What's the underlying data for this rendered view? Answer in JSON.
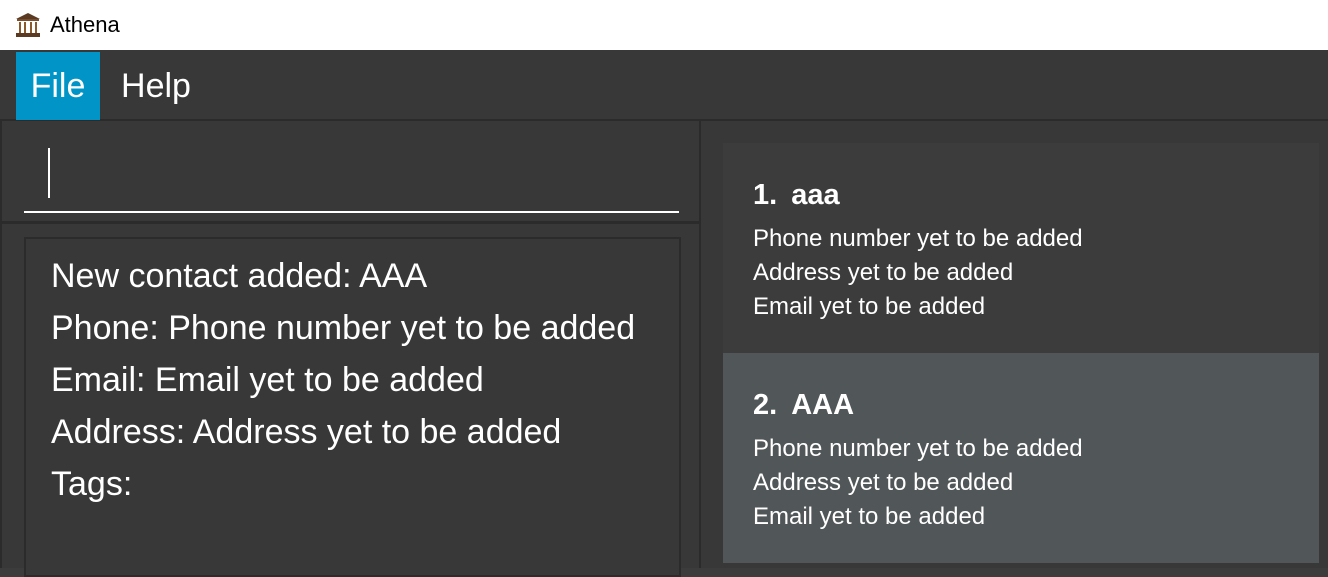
{
  "window": {
    "title": "Athena",
    "icon": "temple-icon"
  },
  "menu": {
    "file_label": "File",
    "help_label": "Help"
  },
  "command": {
    "value": ""
  },
  "result": {
    "lines": [
      "New contact added: AAA",
      "Phone: Phone number yet to be added",
      "Email: Email yet to be added",
      "Address: Address yet to be added",
      "Tags:"
    ]
  },
  "contacts": [
    {
      "index": "1.",
      "name": "aaa",
      "phone": "Phone number yet to be added",
      "address": "Address yet to be added",
      "email": "Email yet to be added"
    },
    {
      "index": "2.",
      "name": "AAA",
      "phone": "Phone number yet to be added",
      "address": "Address yet to be added",
      "email": "Email yet to be added"
    }
  ],
  "colors": {
    "accent": "#0094c7",
    "background": "#383838",
    "selected_card": "#515658"
  }
}
